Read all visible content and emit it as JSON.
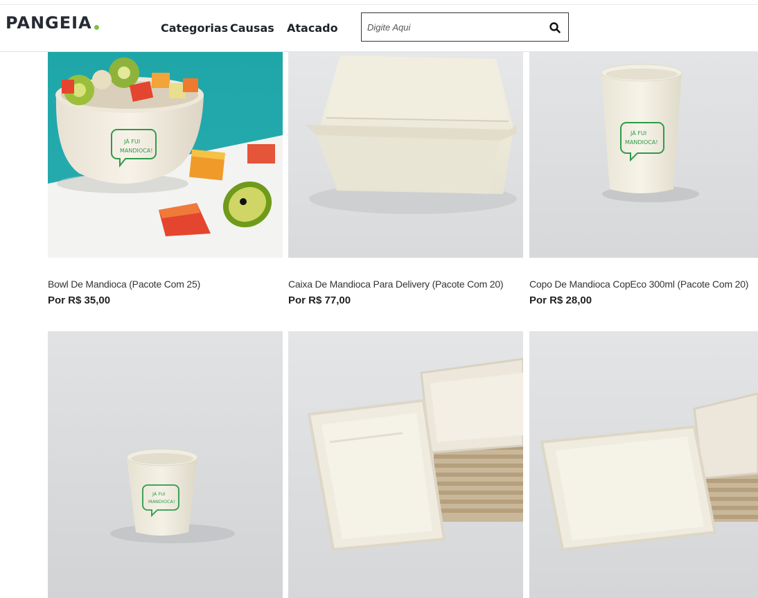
{
  "header": {
    "logo_text": "PANGEIA",
    "logo_dot_color": "#7cc242",
    "nav": [
      "Categorias",
      "Causas",
      "Atacado"
    ],
    "search": {
      "placeholder": "Digite Aqui",
      "icon": "search-icon"
    }
  },
  "products": [
    {
      "name": "Bowl De Mandioca (Pacote Com 25)",
      "price": "Por R$ 35,00"
    },
    {
      "name": "Caixa De Mandioca Para Delivery (Pacote Com 20)",
      "price": "Por R$ 77,00"
    },
    {
      "name": "Copo De Mandioca CopEco 300ml (Pacote Com 20)",
      "price": "Por R$ 28,00"
    },
    {
      "name": "",
      "price": ""
    },
    {
      "name": "",
      "price": ""
    },
    {
      "name": "",
      "price": ""
    }
  ],
  "printed_text": {
    "cup_label": [
      "JÁ FUI",
      "MANDIOCA!"
    ]
  }
}
